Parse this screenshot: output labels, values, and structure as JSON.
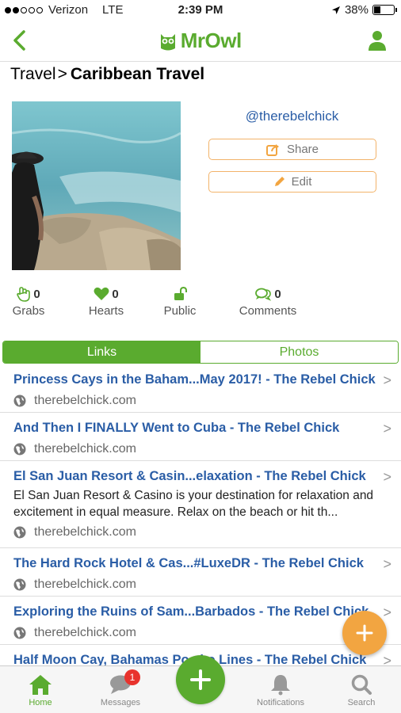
{
  "status_bar": {
    "carrier": "Verizon",
    "network": "LTE",
    "time": "2:39 PM",
    "battery": "38%",
    "battery_level": 0.38
  },
  "nav": {
    "logo": "MrOwl"
  },
  "breadcrumb": {
    "parent": "Travel",
    "separator": ">",
    "current": "Caribbean Travel"
  },
  "profile": {
    "handle": "@therebelchick",
    "share_label": "Share",
    "edit_label": "Edit"
  },
  "stats": [
    {
      "count": "0",
      "label": "Grabs"
    },
    {
      "count": "0",
      "label": "Hearts"
    },
    {
      "count": "",
      "label": "Public"
    },
    {
      "count": "0",
      "label": "Comments"
    }
  ],
  "tabs": {
    "links": "Links",
    "photos": "Photos"
  },
  "links": [
    {
      "title": "Princess Cays in the Baham...May 2017! - The Rebel Chick",
      "desc": "",
      "source": "therebelchick.com"
    },
    {
      "title": "And Then I FINALLY Went to Cuba - The Rebel Chick",
      "desc": "",
      "source": "therebelchick.com"
    },
    {
      "title": "El San Juan Resort & Casin...elaxation - The Rebel Chick",
      "desc": "El San Juan Resort & Casino is your destination for relaxation and excitement in equal measure. Relax on the beach or hit th...",
      "source": "therebelchick.com"
    },
    {
      "title": "The Hard Rock Hotel & Cas...#LuxeDR - The Rebel Chick",
      "desc": "",
      "source": "therebelchick.com"
    },
    {
      "title": "Exploring the Ruins of Sam...Barbados - The Rebel Chick",
      "desc": "",
      "source": "therebelchick.com"
    },
    {
      "title": "Half Moon Cay, Bahamas Po...he Lines - The Rebel Chick",
      "desc": "",
      "source": ""
    }
  ],
  "tabbar": {
    "home": "Home",
    "messages": "Messages",
    "messages_badge": "1",
    "notifications": "Notifications",
    "search": "Search"
  },
  "colors": {
    "brand_green": "#5aab2f",
    "accent_orange": "#f2a541",
    "link_blue": "#2a5da6",
    "badge_red": "#e8332d"
  }
}
